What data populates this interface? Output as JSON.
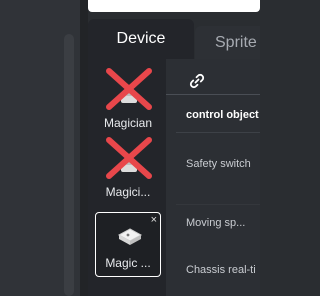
{
  "tabs": {
    "device": "Device",
    "sprite": "Sprite"
  },
  "devices": [
    {
      "label": "Magician",
      "removed": true
    },
    {
      "label": "Magici...",
      "removed": true
    },
    {
      "label": "Magic ...",
      "removed": false,
      "selected": true,
      "close": "×"
    }
  ],
  "panel": {
    "section_title": "control object",
    "fields": {
      "safety_switch": "Safety switch",
      "moving_speed": "Moving sp... ",
      "chassis": "Chassis real-ti"
    }
  },
  "colors": {
    "remove_mark": "#e8474b",
    "accent": "#ffffff"
  }
}
